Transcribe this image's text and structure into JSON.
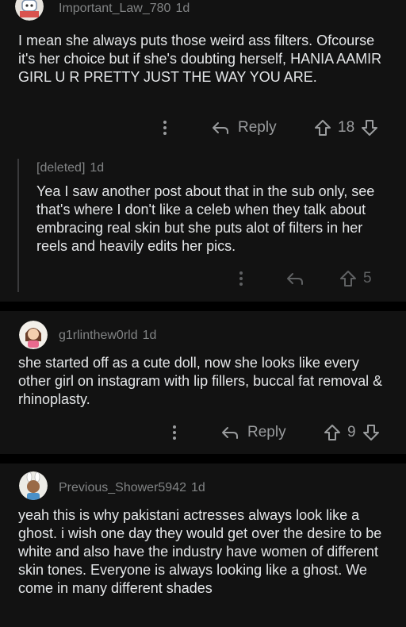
{
  "comments": [
    {
      "username": "Important_Law_780",
      "age": "1d",
      "body": "I mean she always puts those weird ass filters. Ofcourse it's her choice but if she's doubting herself, HANIA AAMIR GIRL U R PRETTY JUST THE WAY YOU ARE.",
      "reply_label": "Reply",
      "score": "18"
    },
    {
      "username": "[deleted]",
      "age": "1d",
      "body": "Yea I saw another post about that in the sub only, see that's where I don't like a celeb when they talk about embracing real skin but she puts alot of filters in her reels and heavily edits her pics.",
      "score": "5"
    },
    {
      "username": "g1rlinthew0rld",
      "age": "1d",
      "body": "she started off as a cute doll, now she looks like every other girl on instagram with lip fillers, buccal fat removal & rhinoplasty.",
      "reply_label": "Reply",
      "score": "9"
    },
    {
      "username": "Previous_Shower5942",
      "age": "1d",
      "body": "yeah this is why pakistani actresses always look like a ghost. i wish one day they would get over the desire to be white and also have the industry have women of different skin tones. Everyone is always looking like a ghost. We come in many different shades"
    }
  ],
  "colors": {
    "background": "#000000",
    "card": "#121212",
    "text": "#e4e6e8",
    "muted": "#818384"
  }
}
